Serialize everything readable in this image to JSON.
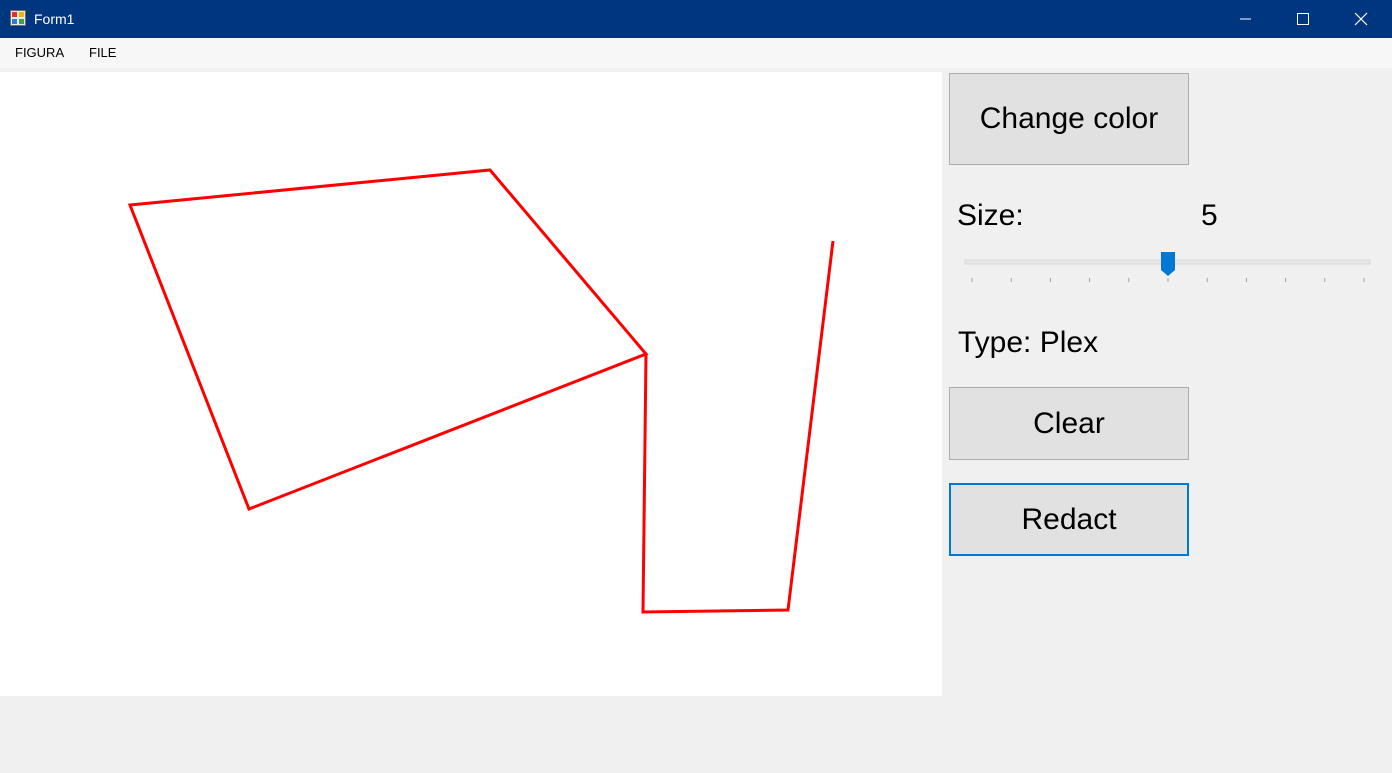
{
  "window": {
    "title": "Form1",
    "app_icon": "form-app-icon",
    "controls": [
      "minimize-icon",
      "maximize-icon",
      "close-icon"
    ],
    "titlebar_color": "#003680"
  },
  "menu": {
    "items": [
      {
        "label": "FIGURA"
      },
      {
        "label": "FILE"
      }
    ]
  },
  "canvas": {
    "stroke_color": "#ff0000"
  },
  "panel": {
    "change_color_label": "Change color",
    "size_label": "Size:",
    "size_value": "5",
    "size_slider": {
      "value": 5,
      "min": 0,
      "max": 10
    },
    "type_label": "Type: Plex",
    "clear_label": "Clear",
    "redact_label": "Redact",
    "accent_color": "#0078d7"
  }
}
